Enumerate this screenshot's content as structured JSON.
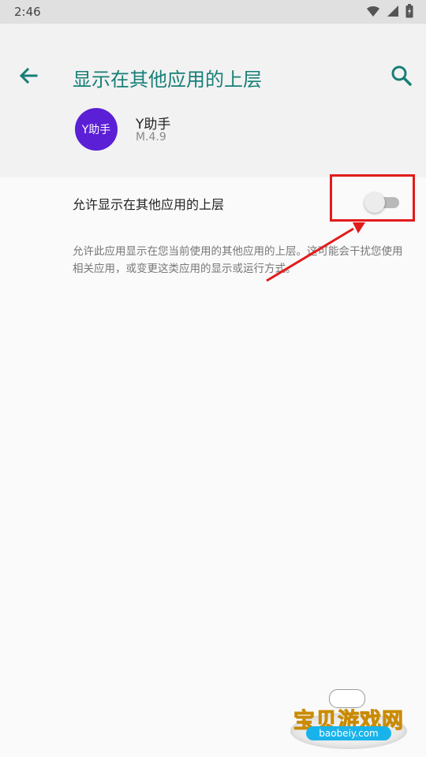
{
  "status_bar": {
    "time": "2:46",
    "icons": [
      "wifi-icon",
      "signal-icon",
      "battery-icon"
    ]
  },
  "header": {
    "title": "显示在其他应用的上层",
    "back_icon": "arrow-left-icon",
    "search_icon": "search-icon"
  },
  "app": {
    "icon_text": "Y助手",
    "name": "Y助手",
    "version": "M.4.9",
    "icon_color": "#5b1fd6"
  },
  "setting": {
    "label": "允许显示在其他应用的上层",
    "enabled": false,
    "description": "允许此应用显示在您当前使用的其他应用的上层。这可能会干扰您使用相关应用，或变更这类应用的显示或运行方式。"
  },
  "annotation": {
    "box_color": "#e21b1b",
    "arrow_color": "#e21b1b"
  },
  "watermark": {
    "main": "宝贝游戏网",
    "url": "baobeiy.com"
  },
  "colors": {
    "accent": "#167f77",
    "background": "#fafafa"
  }
}
